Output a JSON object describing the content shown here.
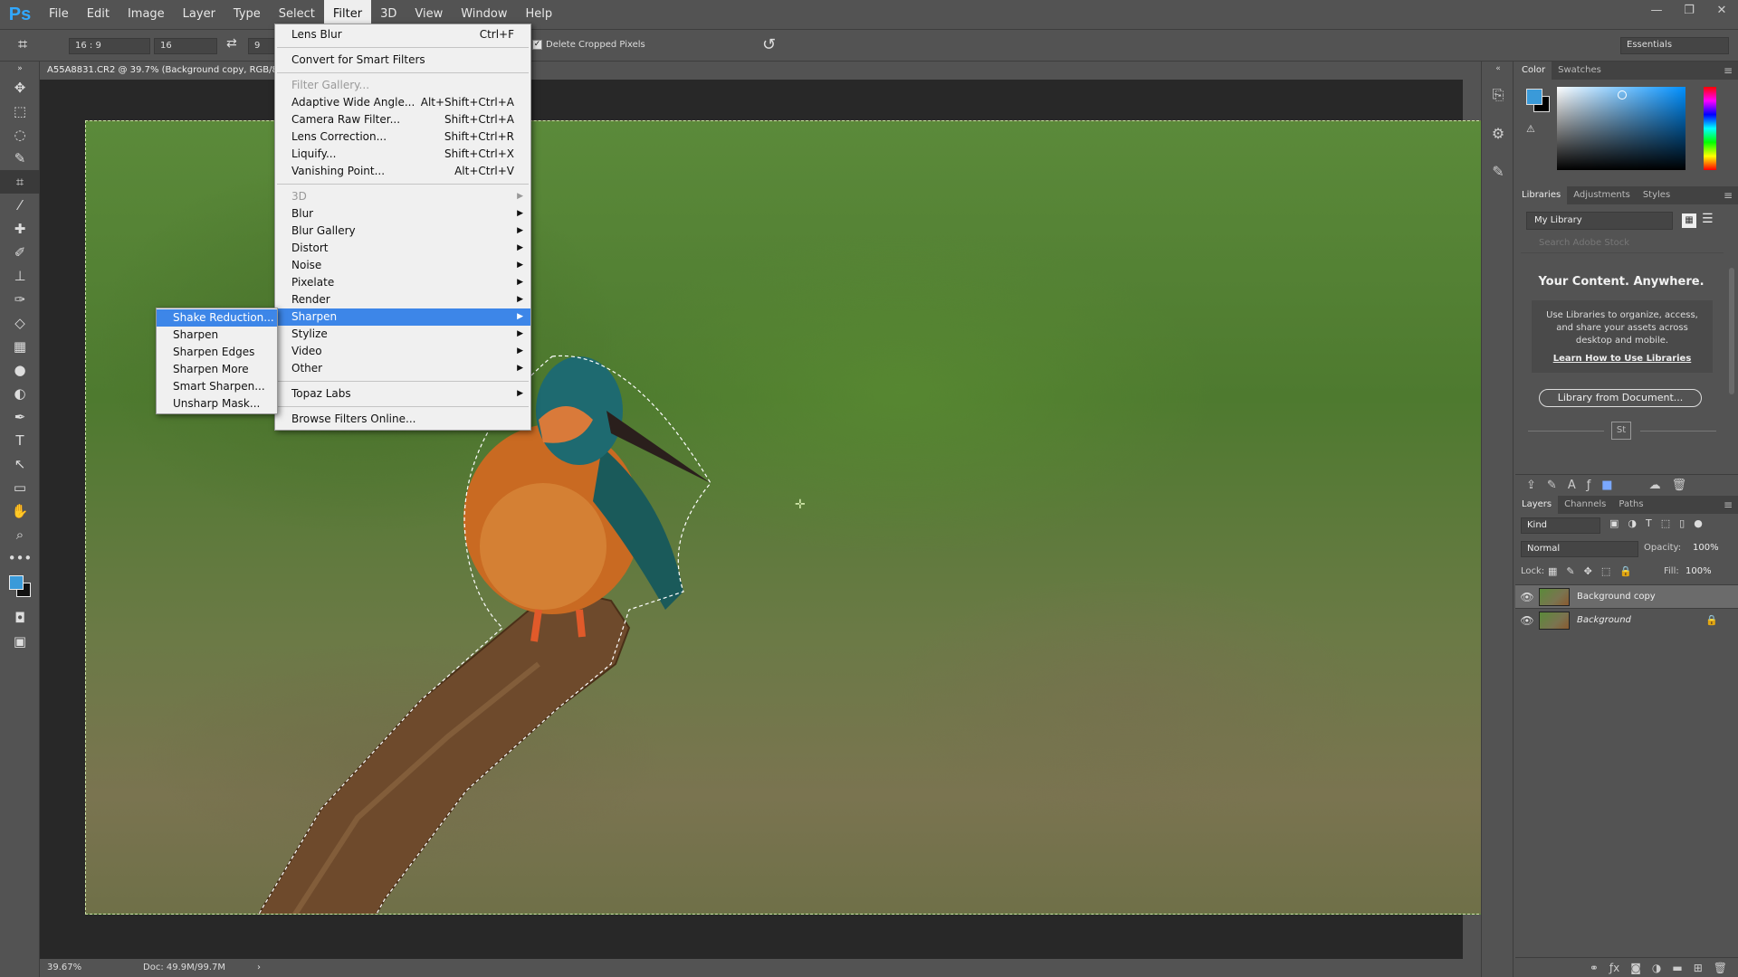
{
  "app": {
    "logo": "Ps"
  },
  "menubar": [
    "File",
    "Edit",
    "Image",
    "Layer",
    "Type",
    "Select",
    "Filter",
    "3D",
    "View",
    "Window",
    "Help"
  ],
  "window_controls": [
    "—",
    "❐",
    "✕"
  ],
  "options": {
    "ratio": "16 : 9",
    "width": "16",
    "height": "9",
    "delete_cropped": "Delete Cropped Pixels",
    "workspace": "Essentials"
  },
  "document": {
    "tab_title": "A55A8831.CR2 @ 39.7% (Background copy, RGB/8*)",
    "status_zoom": "39.67%",
    "status_doc": "Doc: 49.9M/99.7M"
  },
  "filter_menu": [
    {
      "label": "Lens Blur",
      "shortcut": "Ctrl+F"
    },
    {
      "sep": true
    },
    {
      "label": "Convert for Smart Filters"
    },
    {
      "sep": true
    },
    {
      "label": "Filter Gallery...",
      "disabled": true
    },
    {
      "label": "Adaptive Wide Angle...",
      "shortcut": "Alt+Shift+Ctrl+A"
    },
    {
      "label": "Camera Raw Filter...",
      "shortcut": "Shift+Ctrl+A"
    },
    {
      "label": "Lens Correction...",
      "shortcut": "Shift+Ctrl+R"
    },
    {
      "label": "Liquify...",
      "shortcut": "Shift+Ctrl+X"
    },
    {
      "label": "Vanishing Point...",
      "shortcut": "Alt+Ctrl+V"
    },
    {
      "sep": true
    },
    {
      "label": "3D",
      "disabled": true,
      "submenu": true
    },
    {
      "label": "Blur",
      "submenu": true
    },
    {
      "label": "Blur Gallery",
      "submenu": true
    },
    {
      "label": "Distort",
      "submenu": true
    },
    {
      "label": "Noise",
      "submenu": true
    },
    {
      "label": "Pixelate",
      "submenu": true
    },
    {
      "label": "Render",
      "submenu": true
    },
    {
      "label": "Sharpen",
      "submenu": true,
      "highlight": true
    },
    {
      "label": "Stylize",
      "submenu": true
    },
    {
      "label": "Video",
      "submenu": true
    },
    {
      "label": "Other",
      "submenu": true
    },
    {
      "sep": true
    },
    {
      "label": "Topaz Labs",
      "submenu": true
    },
    {
      "sep": true
    },
    {
      "label": "Browse Filters Online..."
    }
  ],
  "sharpen_menu": [
    {
      "label": "Shake Reduction...",
      "highlight": true
    },
    {
      "label": "Sharpen"
    },
    {
      "label": "Sharpen Edges"
    },
    {
      "label": "Sharpen More"
    },
    {
      "label": "Smart Sharpen..."
    },
    {
      "label": "Unsharp Mask..."
    }
  ],
  "color_panel": {
    "tabs": [
      "Color",
      "Swatches"
    ],
    "foreground": "#3a9ad9",
    "background": "#000000"
  },
  "libraries_panel": {
    "tabs": [
      "Libraries",
      "Adjustments",
      "Styles"
    ],
    "library": "My Library",
    "search_placeholder": "Search Adobe Stock",
    "title": "Your Content. Anywhere.",
    "description": "Use Libraries to organize, access, and share your assets across desktop and mobile.",
    "link": "Learn How to Use Libraries",
    "button": "Library from Document...",
    "stock_badge": "St"
  },
  "layers_panel": {
    "tabs": [
      "Layers",
      "Channels",
      "Paths"
    ],
    "kind": "Kind",
    "blend_mode": "Normal",
    "opacity_label": "Opacity:",
    "opacity": "100%",
    "lock_label": "Lock:",
    "fill_label": "Fill:",
    "fill": "100%",
    "layers": [
      {
        "name": "Background copy",
        "selected": true
      },
      {
        "name": "Background",
        "locked": true
      }
    ]
  }
}
